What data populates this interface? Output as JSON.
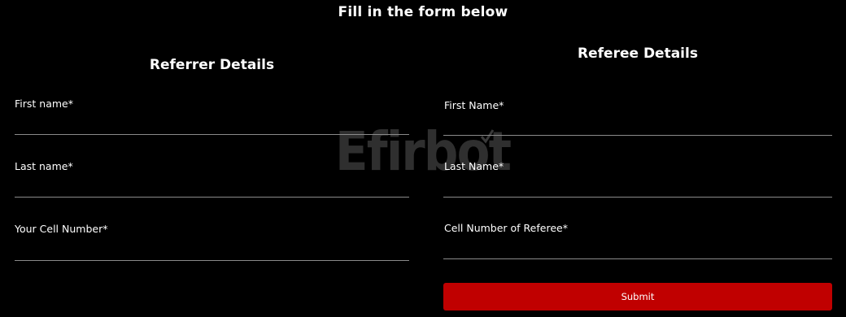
{
  "page": {
    "title": "Fill in the form below"
  },
  "watermark": {
    "text": "Efirbot"
  },
  "referrer": {
    "title": "Referrer Details",
    "fields": {
      "first_name": {
        "label": "First name*"
      },
      "last_name": {
        "label": "Last name*"
      },
      "cell": {
        "label": "Your Cell Number*"
      }
    }
  },
  "referee": {
    "title": "Referee Details",
    "fields": {
      "first_name": {
        "label": "First Name*"
      },
      "last_name": {
        "label": "Last Name*"
      },
      "cell": {
        "label": "Cell Number of Referee*"
      }
    },
    "submit_label": "Submit"
  },
  "colors": {
    "submit": "#c00000",
    "background": "#000000"
  }
}
